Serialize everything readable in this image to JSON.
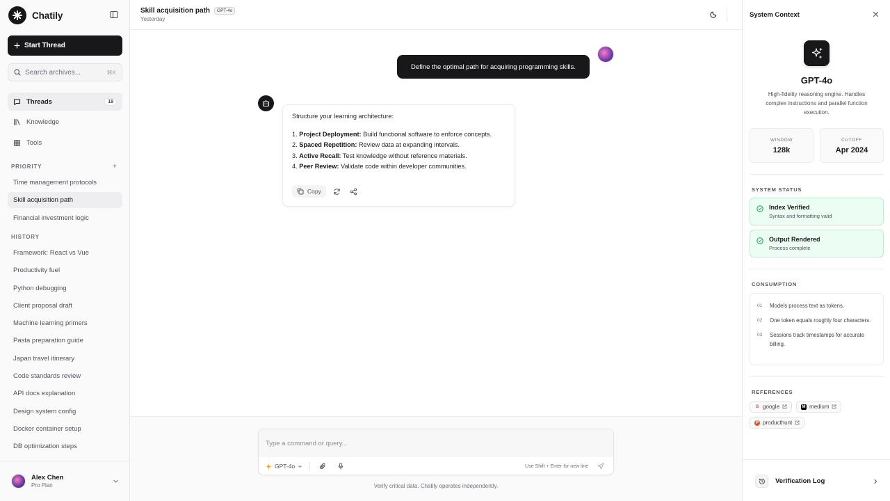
{
  "app": {
    "name": "Chatily"
  },
  "sidebar": {
    "start_label": "Start Thread",
    "search": {
      "placeholder": "Search archives...",
      "shortcut": "⌘K"
    },
    "nav": [
      {
        "label": "Threads",
        "icon": "chat-icon",
        "count": "18",
        "active": true
      },
      {
        "label": "Knowledge",
        "icon": "library-icon"
      },
      {
        "label": "Tools",
        "icon": "grid-icon"
      }
    ],
    "priority_title": "PRIORITY",
    "priority": [
      "Time management protocols",
      "Skill acquisition path",
      "Financial investment logic"
    ],
    "priority_active": "Skill acquisition path",
    "history_title": "HISTORY",
    "history": [
      "Framework: React vs Vue",
      "Productivity fuel",
      "Python debugging",
      "Client proposal draft",
      "Machine learning primers",
      "Pasta preparation guide",
      "Japan travel itinerary",
      "Code standards review",
      "API docs explanation",
      "Design system config",
      "Docker container setup",
      "DB optimization steps"
    ],
    "user": {
      "name": "Alex Chen",
      "plan": "Pro Plan"
    }
  },
  "header": {
    "title": "Skill acquisition path",
    "badge": "GPT-4o",
    "subtitle": "Yesterday"
  },
  "chat": {
    "user_message": "Define the optimal path for acquiring programming skills.",
    "bot": {
      "intro": "Structure your learning architecture:",
      "items": [
        {
          "num": "1.",
          "title": "Project Deployment:",
          "text": "Build functional software to enforce concepts."
        },
        {
          "num": "2.",
          "title": "Spaced Repetition:",
          "text": "Review data at expanding intervals."
        },
        {
          "num": "3.",
          "title": "Active Recall:",
          "text": "Test knowledge without reference materials."
        },
        {
          "num": "4.",
          "title": "Peer Review:",
          "text": "Validate code within developer communities."
        }
      ],
      "copy_label": "Copy"
    }
  },
  "composer": {
    "placeholder": "Type a command or query...",
    "model": "GPT-4o",
    "hint": "Use Shift + Enter for new line",
    "disclaimer": "Verify critical data. Chatily operates independently."
  },
  "panel": {
    "title": "System Context",
    "model_name": "GPT-4o",
    "model_desc": "High-fidelity reasoning engine. Handles complex instructions and parallel function execution.",
    "stats": [
      {
        "label": "WINDOW",
        "value": "128k"
      },
      {
        "label": "CUTOFF",
        "value": "Apr 2024"
      }
    ],
    "status_title": "SYSTEM STATUS",
    "statuses": [
      {
        "title": "Index Verified",
        "sub": "Syntax and formatting valid"
      },
      {
        "title": "Output Rendered",
        "sub": "Process complete"
      }
    ],
    "consumption_title": "CONSUMPTION",
    "consumption": [
      {
        "num": "01",
        "text": "Models process text as tokens."
      },
      {
        "num": "02",
        "text": "One token equals roughly four characters."
      },
      {
        "num": "03",
        "text": "Sessions track timestamps for accurate billing."
      }
    ],
    "references_title": "REFERENCES",
    "references": [
      {
        "label": "google",
        "glyph": "G",
        "color": "#ea4335"
      },
      {
        "label": "medium",
        "glyph": "M",
        "color": "#000000"
      },
      {
        "label": "producthunt",
        "glyph": "P",
        "color": "#da552f"
      }
    ],
    "verification_label": "Verification Log"
  }
}
